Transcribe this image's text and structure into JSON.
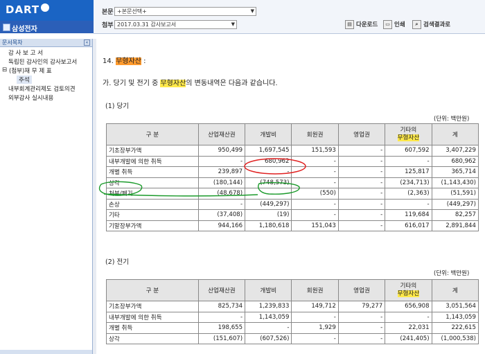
{
  "header": {
    "logo_text": "DART",
    "company_name": "삼성전자",
    "bonmun_label": "본문",
    "bonmun_value": "+본문선택+",
    "cheombu_label": "첨부",
    "cheombu_value": "2017.03.31  감사보고서",
    "download_label": "다운로드",
    "print_label": "인쇄",
    "search_label": "검색결과로"
  },
  "sidebar": {
    "title": "문서목차",
    "collapse": "«",
    "items": [
      {
        "label": "감 사 보 고 서"
      },
      {
        "label": "독립된 감사인의 감사보고서"
      },
      {
        "label": "(첨부)재 무 제 표"
      },
      {
        "label": "주석"
      },
      {
        "label": "내부회계관리제도 검토의견"
      },
      {
        "label": "외부감사 실시내용"
      }
    ]
  },
  "main": {
    "section_num": "14.",
    "section_title": "무형자산",
    "section_colon": ":",
    "intro_pre": "가. 당기 및 전기 중 ",
    "intro_hl": "무형자산",
    "intro_post": "의 변동내역은 다음과 같습니다.",
    "current_label": "(1) 당기",
    "prior_label": "(2) 전기",
    "unit": "(단위: 백만원)",
    "columns": [
      "구     분",
      "산업재산권",
      "개발비",
      "회원권",
      "영업권",
      "기타의",
      "무형자산",
      "계"
    ],
    "current_rows": [
      {
        "label": "기초장부가액",
        "v": [
          "950,499",
          "1,697,545",
          "151,593",
          "-",
          "607,592",
          "3,407,229"
        ]
      },
      {
        "label": "내부개발에 의한 취득",
        "v": [
          "-",
          "680,962",
          "-",
          "-",
          "-",
          "680,962"
        ]
      },
      {
        "label": "개별 취득",
        "v": [
          "239,897",
          "-",
          "-",
          "-",
          "125,817",
          "365,714"
        ]
      },
      {
        "label": "상각",
        "v": [
          "(180,144)",
          "(748,573)",
          "-",
          "-",
          "(234,713)",
          "(1,143,430)"
        ]
      },
      {
        "label": "처분/폐기",
        "v": [
          "(48,678)",
          "-",
          "(550)",
          "-",
          "(2,363)",
          "(51,591)"
        ]
      },
      {
        "label": "손상",
        "v": [
          "-",
          "(449,297)",
          "-",
          "-",
          "-",
          "(449,297)"
        ]
      },
      {
        "label": "기타",
        "v": [
          "(37,408)",
          "(19)",
          "-",
          "-",
          "119,684",
          "82,257"
        ]
      },
      {
        "label": "기말장부가액",
        "v": [
          "944,166",
          "1,180,618",
          "151,043",
          "-",
          "616,017",
          "2,891,844"
        ]
      }
    ],
    "prior_rows": [
      {
        "label": "기초장부가액",
        "v": [
          "825,734",
          "1,239,833",
          "149,712",
          "79,277",
          "656,908",
          "3,051,564"
        ]
      },
      {
        "label": "내부개발에 의한 취득",
        "v": [
          "-",
          "1,143,059",
          "-",
          "-",
          "-",
          "1,143,059"
        ]
      },
      {
        "label": "개별 취득",
        "v": [
          "198,655",
          "-",
          "1,929",
          "-",
          "22,031",
          "222,615"
        ]
      },
      {
        "label": "상각",
        "v": [
          "(151,607)",
          "(607,526)",
          "-",
          "-",
          "(241,405)",
          "(1,000,538)"
        ]
      }
    ],
    "annotation_colors": {
      "red_circle": "#e02020",
      "green_marks": "#1a9a2a"
    }
  }
}
